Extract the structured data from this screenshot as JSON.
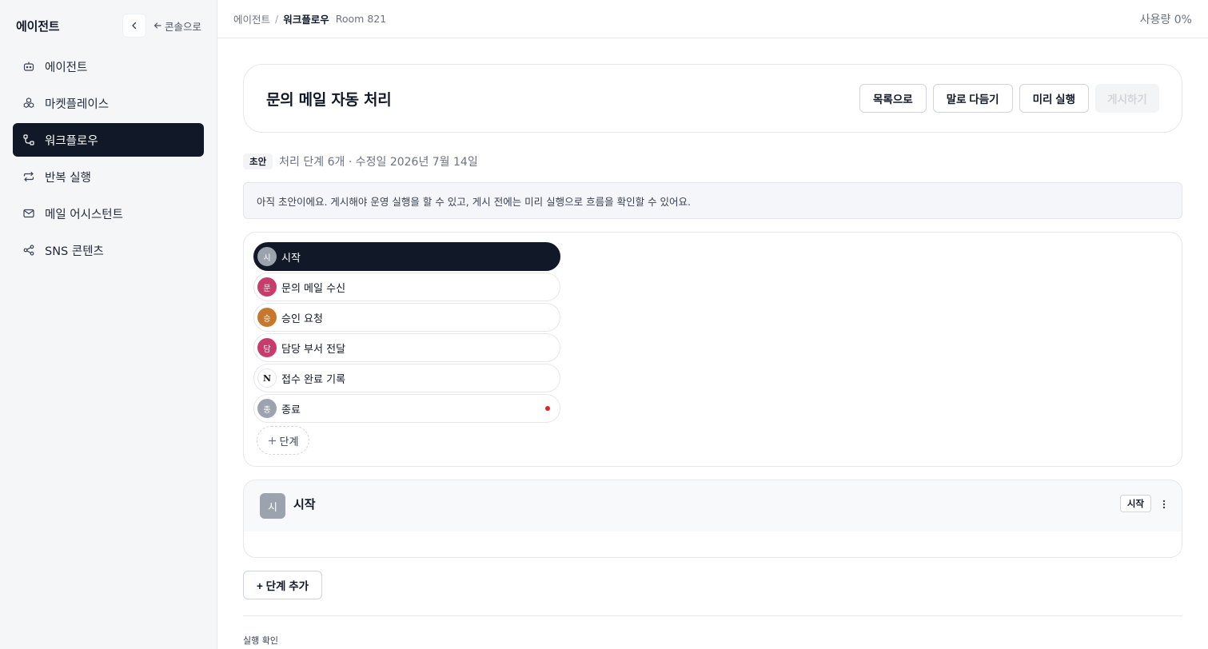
{
  "sidebar": {
    "brand": "에이전트",
    "console_link": "콘솔으로",
    "items": [
      {
        "label": "에이전트",
        "icon": "bot-icon"
      },
      {
        "label": "마켓플레이스",
        "icon": "cubes-icon"
      },
      {
        "label": "워크플로우",
        "icon": "workflow-icon",
        "active": true
      },
      {
        "label": "반복 실행",
        "icon": "repeat-icon"
      },
      {
        "label": "메일 어시스턴트",
        "icon": "mail-icon"
      },
      {
        "label": "SNS 콘텐츠",
        "icon": "share-icon"
      }
    ]
  },
  "topbar": {
    "breadcrumb_root": "에이전트",
    "separator": "/",
    "breadcrumb_current": "워크플로우",
    "room": "Room 821",
    "usage": "사용량 0%"
  },
  "header": {
    "title": "문의 메일 자동 처리",
    "buttons": {
      "back": "목록으로",
      "refine": "말로 다듬기",
      "preview": "미리 실행",
      "publish": "게시하기"
    }
  },
  "meta": {
    "badge": "초안",
    "text": "처리 단계 6개 · 수정일 2026년 7월 14일"
  },
  "notice": "아직 초안이에요. 게시해야 운영 실행을 할 수 있고, 게시 전에는 미리 실행으로 흐름을 확인할 수 있어요.",
  "steps": [
    {
      "avatar": "시",
      "label": "시작",
      "color": "#9ca3af",
      "active": true
    },
    {
      "avatar": "문",
      "label": "문의 메일 수신",
      "color": "#c93b6b"
    },
    {
      "avatar": "승",
      "label": "승인 요청",
      "color": "#c7772b"
    },
    {
      "avatar": "담",
      "label": "담당 부서 전달",
      "color": "#c93b6b"
    },
    {
      "avatar": "N",
      "label": "접수 완료 기록",
      "color": "#ffffff",
      "icon": "notion-icon"
    },
    {
      "avatar": "종",
      "label": "종료",
      "color": "#9ca3af",
      "status": "error-dot"
    }
  ],
  "add_step_label": "단계",
  "detail": {
    "avatar": "시",
    "title": "시작",
    "badge": "시작"
  },
  "add_step_button": "+ 단계 추가",
  "run_check_label": "실행 확인"
}
